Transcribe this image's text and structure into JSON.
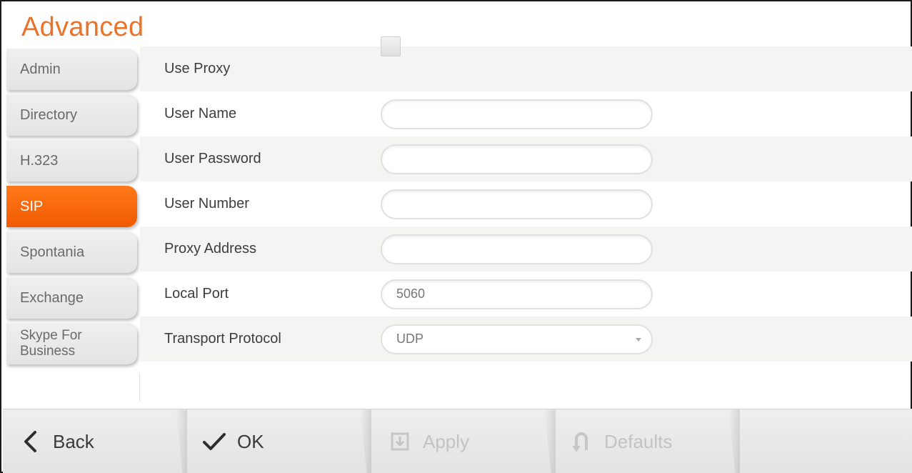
{
  "title": "Advanced",
  "sidebar": {
    "items": [
      {
        "label": "Admin"
      },
      {
        "label": "Directory"
      },
      {
        "label": "H.323"
      },
      {
        "label": "SIP",
        "active": true
      },
      {
        "label": "Spontania"
      },
      {
        "label": "Exchange"
      },
      {
        "label": "Skype For Business"
      }
    ]
  },
  "form": {
    "use_proxy": {
      "label": "Use Proxy",
      "checked": false
    },
    "user_name": {
      "label": "User Name",
      "value": ""
    },
    "user_password": {
      "label": "User Password",
      "value": ""
    },
    "user_number": {
      "label": "User Number",
      "value": ""
    },
    "proxy_address": {
      "label": "Proxy Address",
      "value": ""
    },
    "local_port": {
      "label": "Local Port",
      "value": "5060"
    },
    "transport_protocol": {
      "label": "Transport Protocol",
      "value": "UDP"
    }
  },
  "toolbar": {
    "back": {
      "label": "Back",
      "icon": "chevron-left-icon"
    },
    "ok": {
      "label": "OK",
      "icon": "checkmark-icon"
    },
    "apply": {
      "label": "Apply",
      "icon": "apply-icon",
      "disabled": true
    },
    "defaults": {
      "label": "Defaults",
      "icon": "undo-icon",
      "disabled": true
    }
  },
  "colors": {
    "accent": "#e8732a",
    "active_tab": "#f46500",
    "disabled_text": "#c3c3c3"
  }
}
